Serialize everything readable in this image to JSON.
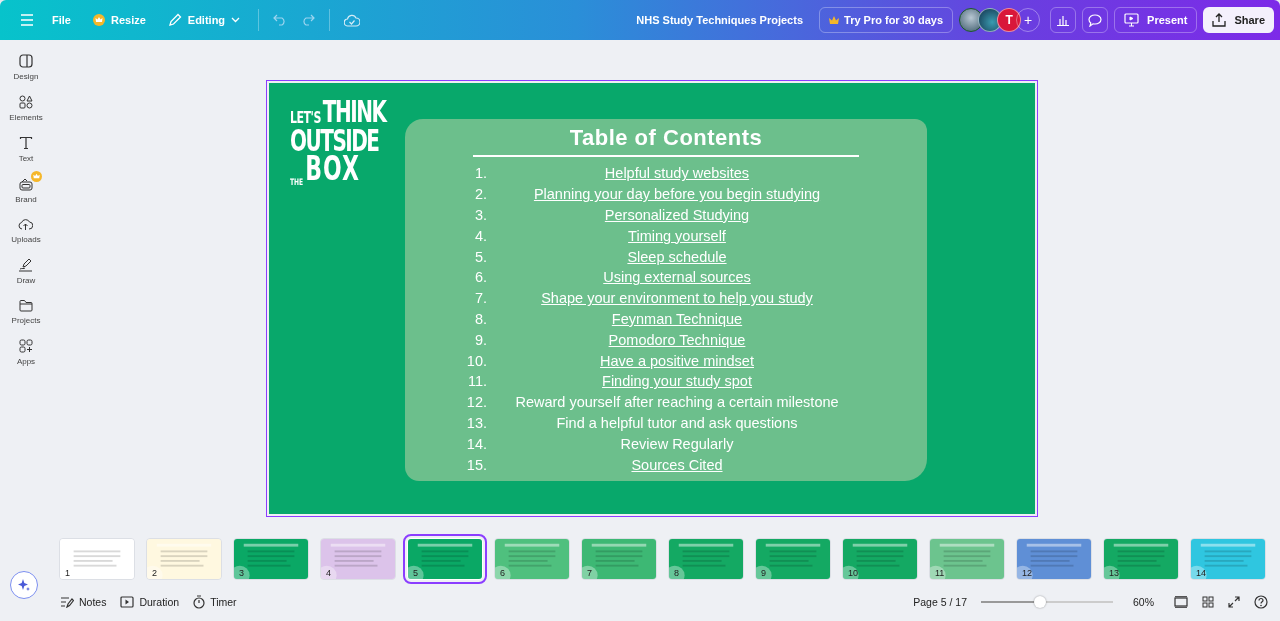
{
  "topbar": {
    "file": "File",
    "resize": "Resize",
    "editing": "Editing",
    "title": "NHS Study Techniques Projects",
    "try_pro": "Try Pro for 30 days",
    "avatar_letter": "T",
    "add": "+",
    "present": "Present",
    "share": "Share"
  },
  "sidebar": {
    "items": [
      {
        "label": "Design",
        "kind": "design",
        "badge": false
      },
      {
        "label": "Elements",
        "kind": "elements",
        "badge": false
      },
      {
        "label": "Text",
        "kind": "text",
        "badge": false
      },
      {
        "label": "Brand",
        "kind": "brand",
        "badge": true
      },
      {
        "label": "Uploads",
        "kind": "uploads",
        "badge": false
      },
      {
        "label": "Draw",
        "kind": "draw",
        "badge": false
      },
      {
        "label": "Projects",
        "kind": "projects",
        "badge": false
      },
      {
        "label": "Apps",
        "kind": "apps",
        "badge": false
      }
    ]
  },
  "slide": {
    "logo": [
      "LET'S",
      "THINK",
      "OUTSIDE",
      "THE",
      "BOX"
    ],
    "title": "Table of Contents",
    "items": [
      {
        "number": "1.",
        "text": "Helpful study websites",
        "link": true
      },
      {
        "number": "2.",
        "text": "Planning your day before you begin studying",
        "link": true
      },
      {
        "number": "3.",
        "text": "Personalized Studying",
        "link": true
      },
      {
        "number": "4.",
        "text": "Timing yourself",
        "link": true
      },
      {
        "number": "5.",
        "text": "Sleep schedule",
        "link": true
      },
      {
        "number": "6.",
        "text": "Using external sources",
        "link": true
      },
      {
        "number": "7.",
        "text": "Shape your environment to help you study",
        "link": true
      },
      {
        "number": "8.",
        "text": "Feynman Technique",
        "link": true
      },
      {
        "number": "9.",
        "text": "Pomodoro Technique",
        "link": true
      },
      {
        "number": "10.",
        "text": "Have a positive mindset",
        "link": true
      },
      {
        "number": "11.",
        "text": "Finding your study spot",
        "link": true
      },
      {
        "number": "12.",
        "text": "Reward yourself after reaching a certain milestone",
        "link": false
      },
      {
        "number": "13.",
        "text": "Find a helpful tutor and ask questions",
        "link": false
      },
      {
        "number": "14.",
        "text": "Review Regularly",
        "link": false
      },
      {
        "number": "15.",
        "text": "Sources Cited",
        "link": true
      }
    ]
  },
  "filmstrip": [
    {
      "number": "1",
      "color": "#ffffff",
      "selected": false
    },
    {
      "number": "2",
      "color": "#fff8e0",
      "selected": false
    },
    {
      "number": "3",
      "color": "#0aa865",
      "selected": false
    },
    {
      "number": "4",
      "color": "#dcc3ea",
      "selected": false
    },
    {
      "number": "5",
      "color": "#0aa865",
      "selected": true
    },
    {
      "number": "6",
      "color": "#4fc07e",
      "selected": false
    },
    {
      "number": "7",
      "color": "#3db874",
      "selected": false
    },
    {
      "number": "8",
      "color": "#14a963",
      "selected": false
    },
    {
      "number": "9",
      "color": "#14a963",
      "selected": false
    },
    {
      "number": "10",
      "color": "#14a963",
      "selected": false
    },
    {
      "number": "11",
      "color": "#6cc48e",
      "selected": false
    },
    {
      "number": "12",
      "color": "#5f8fd6",
      "selected": false
    },
    {
      "number": "13",
      "color": "#14a963",
      "selected": false
    },
    {
      "number": "14",
      "color": "#2fc6e0",
      "selected": false
    }
  ],
  "footer": {
    "notes": "Notes",
    "duration": "Duration",
    "timer": "Timer",
    "page": "Page 5 / 17",
    "zoom": {
      "level": 0.45,
      "reading": "60%"
    }
  }
}
